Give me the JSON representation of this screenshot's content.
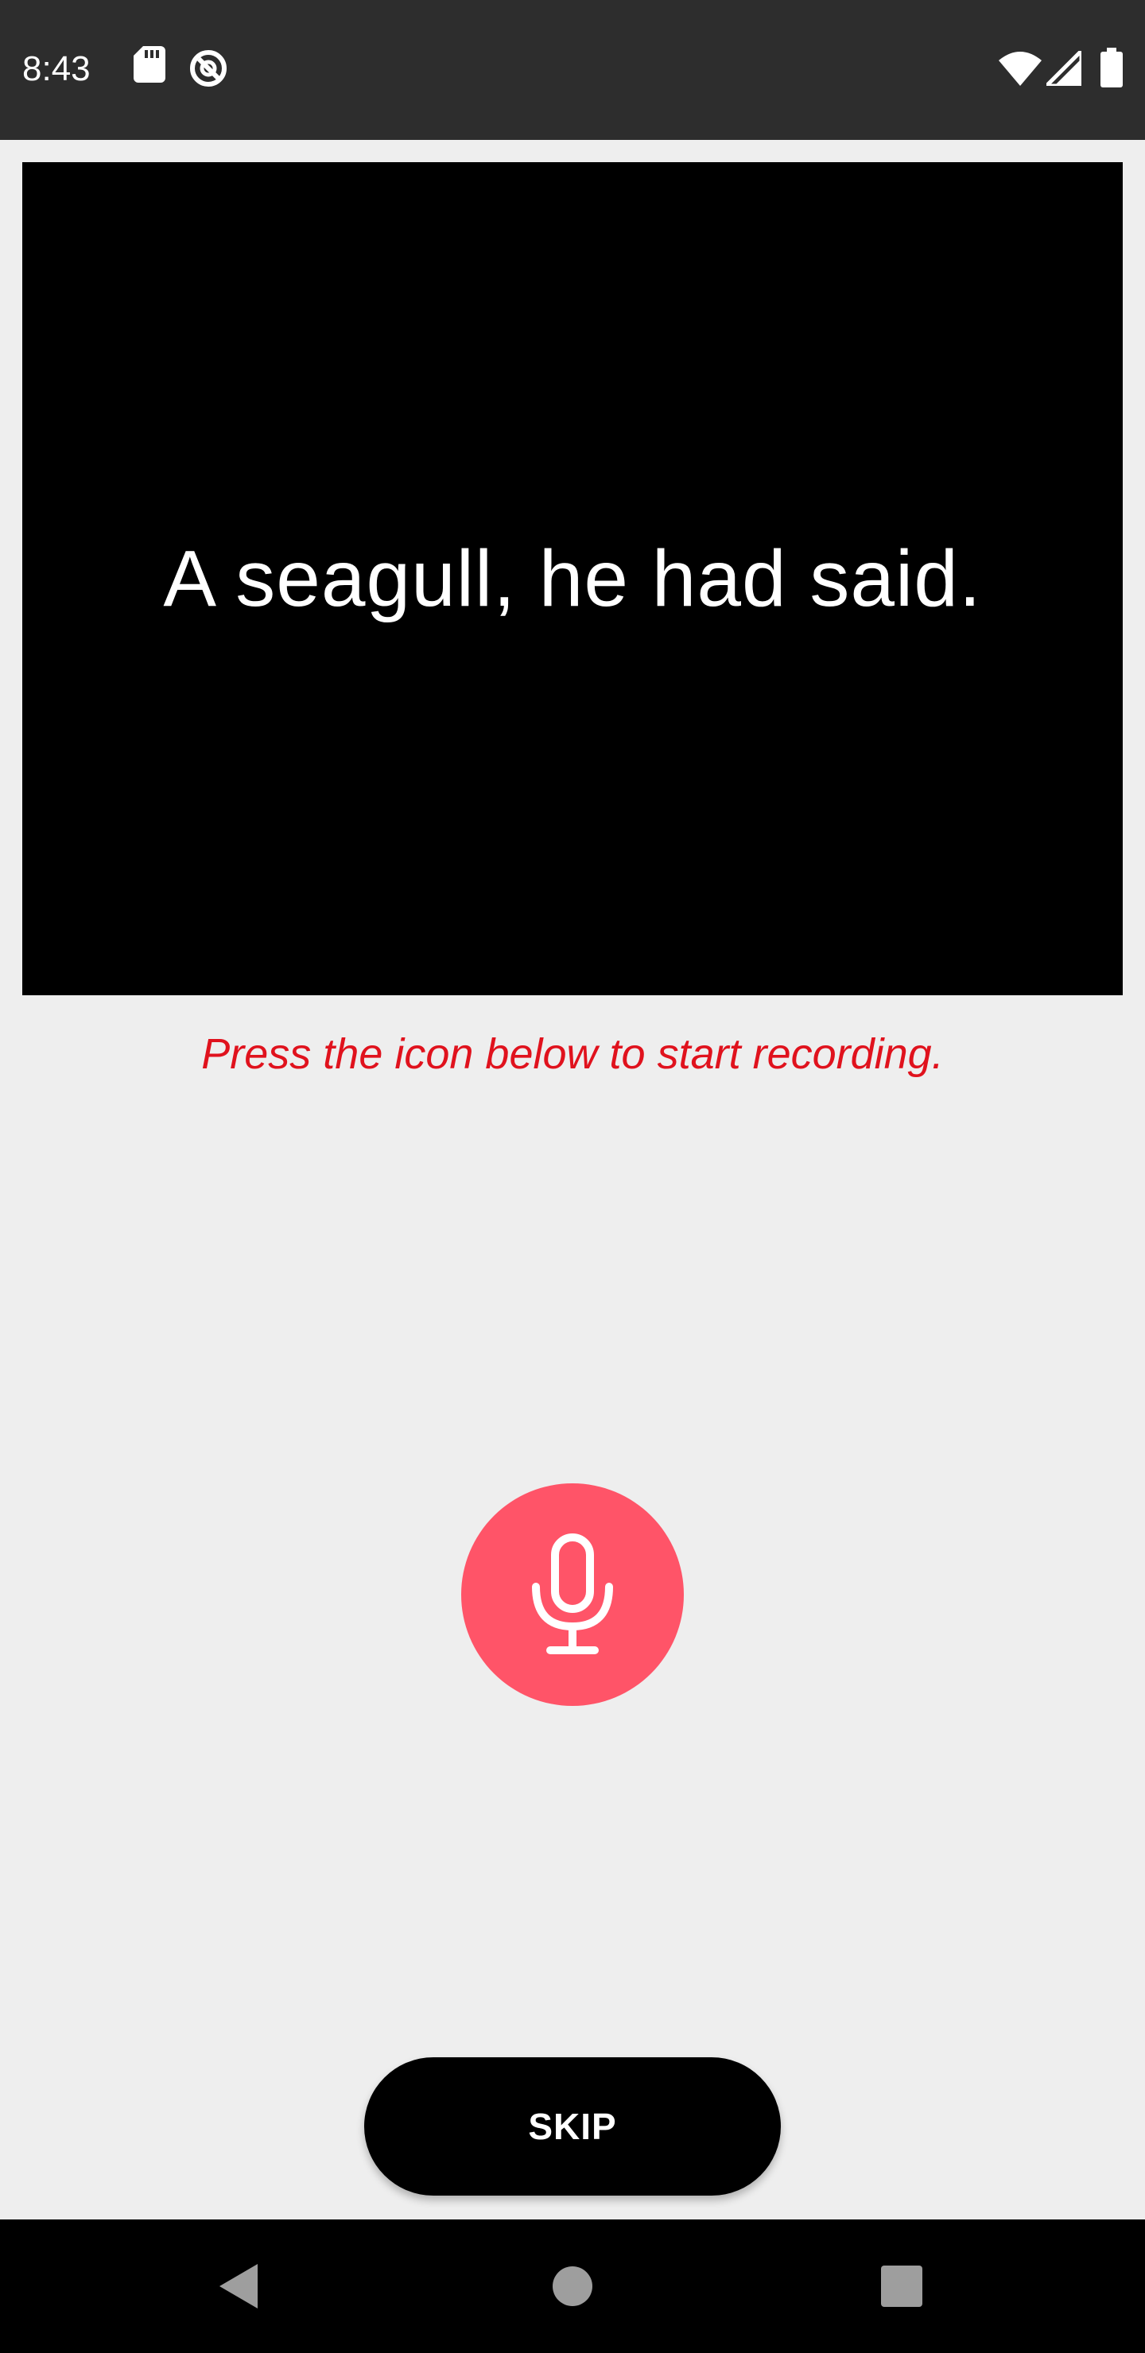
{
  "status_bar": {
    "time": "8:43",
    "left_icons": [
      "sd-card-icon",
      "data-saver-icon"
    ],
    "right_icons": [
      "wifi-icon",
      "signal-icon",
      "battery-icon"
    ]
  },
  "prompt": {
    "text": "A seagull, he had said."
  },
  "instruction": {
    "text": "Press the icon below to start recording."
  },
  "record_button": {
    "icon": "microphone-icon",
    "color": "#ff5468"
  },
  "skip_button": {
    "label": "SKIP"
  },
  "nav_bar": {
    "buttons": [
      "back-icon",
      "home-icon",
      "recents-icon"
    ]
  },
  "colors": {
    "instruction": "#e0121d",
    "background": "#eeeeee",
    "status_bar": "#2d2d2d"
  }
}
